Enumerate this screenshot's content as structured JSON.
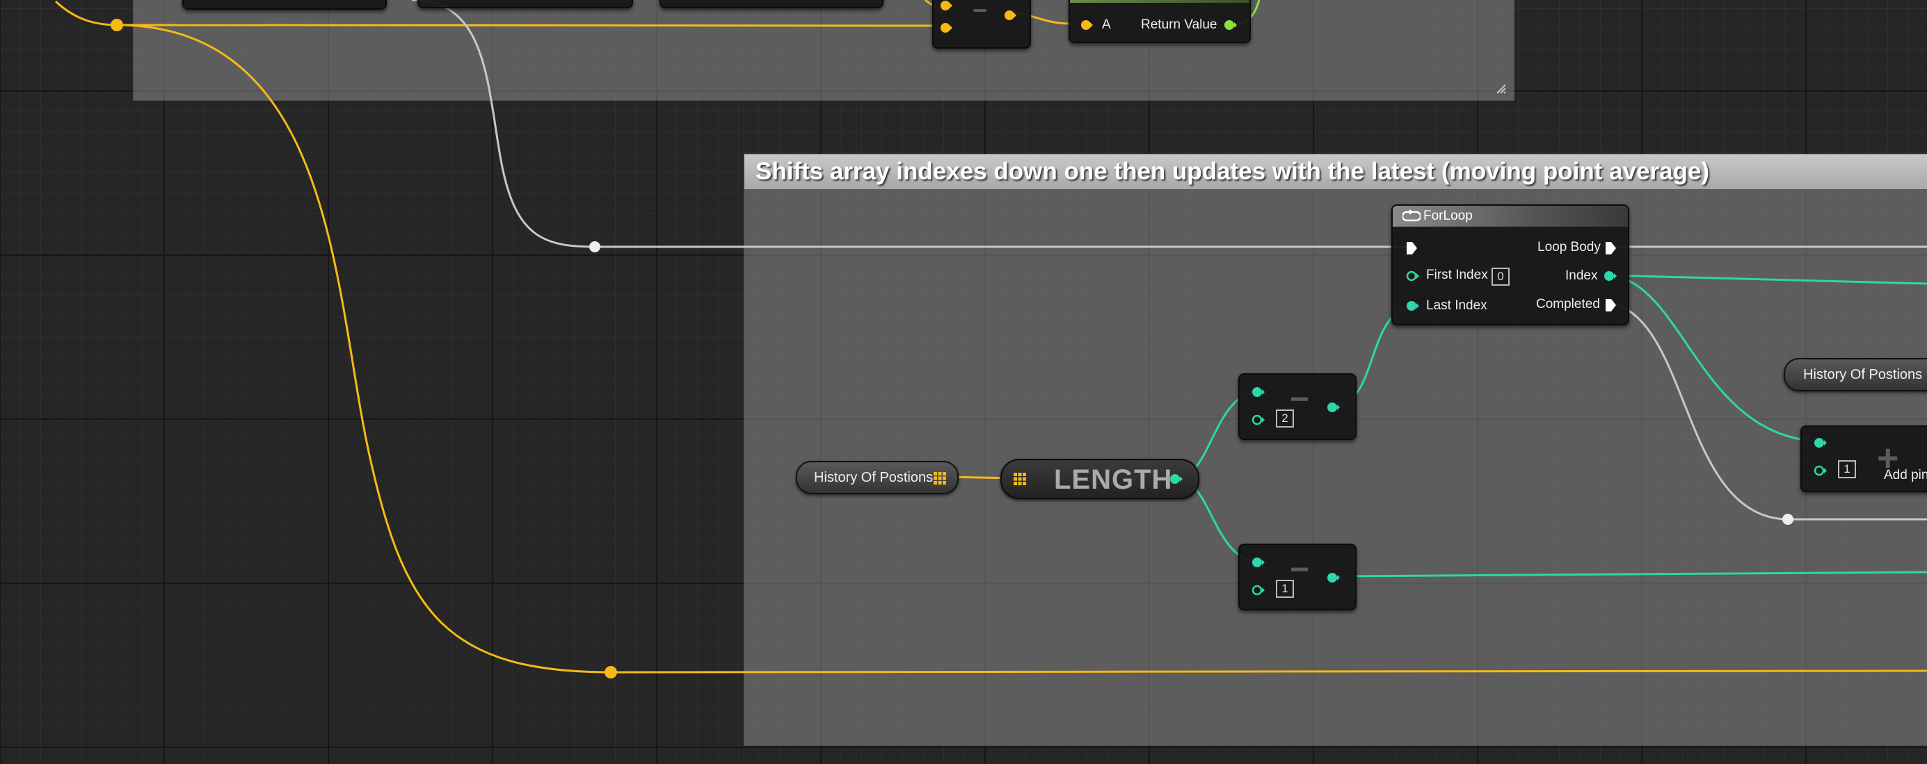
{
  "colors": {
    "exec_wire": "#c8c8c8",
    "int_wire": "#2fd6a8",
    "float_wire": "#f6b916",
    "bool_wire": "#8fe13c"
  },
  "comment_main": {
    "title": "Shifts array indexes down one then updates with the latest (moving point average)"
  },
  "top_partial_node": {
    "pin_a_label": "A",
    "return_label": "Return Value"
  },
  "forloop": {
    "title": "ForLoop",
    "icon": "loop-icon",
    "first_index_label": "First Index",
    "first_index_value": "0",
    "last_index_label": "Last Index",
    "loop_body_label": "Loop Body",
    "index_label": "Index",
    "completed_label": "Completed"
  },
  "history_var_left": {
    "label": "History Of Postions",
    "icon": "array-grid-icon"
  },
  "history_var_right": {
    "label": "History Of Postions"
  },
  "length_node": {
    "label": "LENGTH",
    "icon": "array-grid-icon"
  },
  "subtract_node_top": {
    "operator": "−",
    "b_value": "2"
  },
  "subtract_node_bottom": {
    "operator": "−",
    "b_value": "1"
  },
  "add_node": {
    "operator": "+",
    "b_value": "1",
    "add_pin_label": "Add pin"
  }
}
